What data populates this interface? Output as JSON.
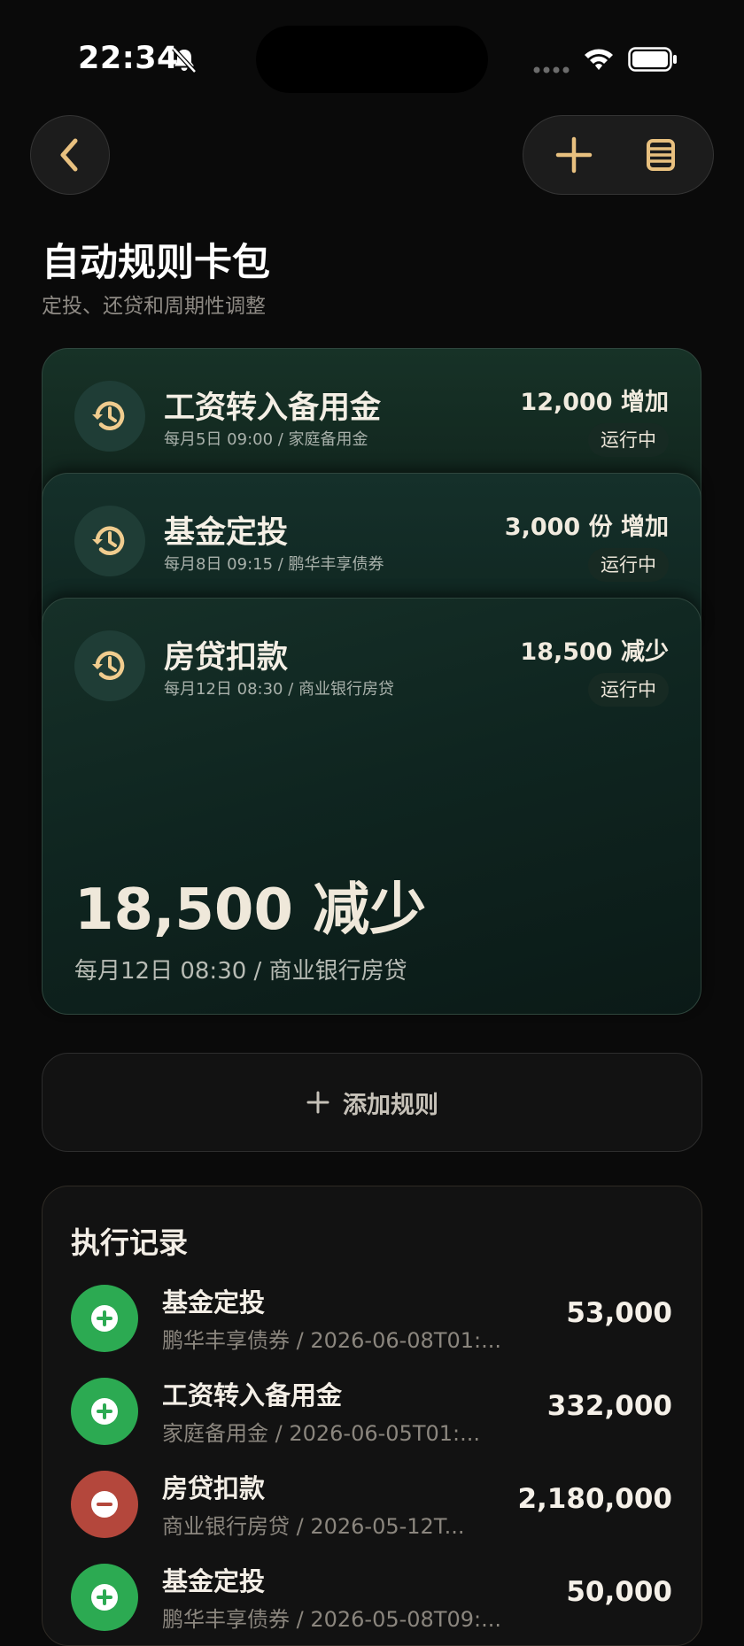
{
  "status_bar": {
    "time": "22:34"
  },
  "header": {
    "title": "自动规则卡包",
    "subtitle": "定投、还贷和周期性调整"
  },
  "rules": [
    {
      "name": "工资转入备用金",
      "meta": "每月5日 09:00 / 家庭备用金",
      "amount": "12,000 增加",
      "status": "运行中"
    },
    {
      "name": "基金定投",
      "meta": "每月8日 09:15 / 鹏华丰享债券",
      "amount": "3,000 份 增加",
      "status": "运行中"
    },
    {
      "name": "房贷扣款",
      "meta": "每月12日 08:30 / 商业银行房贷",
      "amount": "18,500 减少",
      "status": "运行中"
    }
  ],
  "selected_rule": {
    "amount": "18,500 减少",
    "meta": "每月12日 08:30 / 商业银行房贷"
  },
  "add_rule": {
    "label": "添加规则"
  },
  "log": {
    "title": "执行记录",
    "rows": [
      {
        "type": "increase",
        "name": "基金定投",
        "meta": "鹏华丰享债券 / 2026-06-08T01:...",
        "amount": "53,000"
      },
      {
        "type": "increase",
        "name": "工资转入备用金",
        "meta": "家庭备用金 / 2026-06-05T01:...",
        "amount": "332,000"
      },
      {
        "type": "decrease",
        "name": "房贷扣款",
        "meta": "商业银行房贷 / 2026-05-12T...",
        "amount": "2,180,000"
      },
      {
        "type": "increase",
        "name": "基金定投",
        "meta": "鹏华丰享债券 / 2026-05-08T09:...",
        "amount": "50,000"
      }
    ]
  },
  "colors": {
    "accent": "#e8c07f",
    "increase": "#2caa52",
    "decrease": "#b4473c",
    "card_green": "#173227"
  },
  "icons": {
    "back": "chevron-left-icon",
    "add": "plus-icon",
    "list": "list-icon",
    "rule": "history-clock-icon",
    "log_increase": "plus-circle-icon",
    "log_decrease": "minus-circle-icon"
  }
}
